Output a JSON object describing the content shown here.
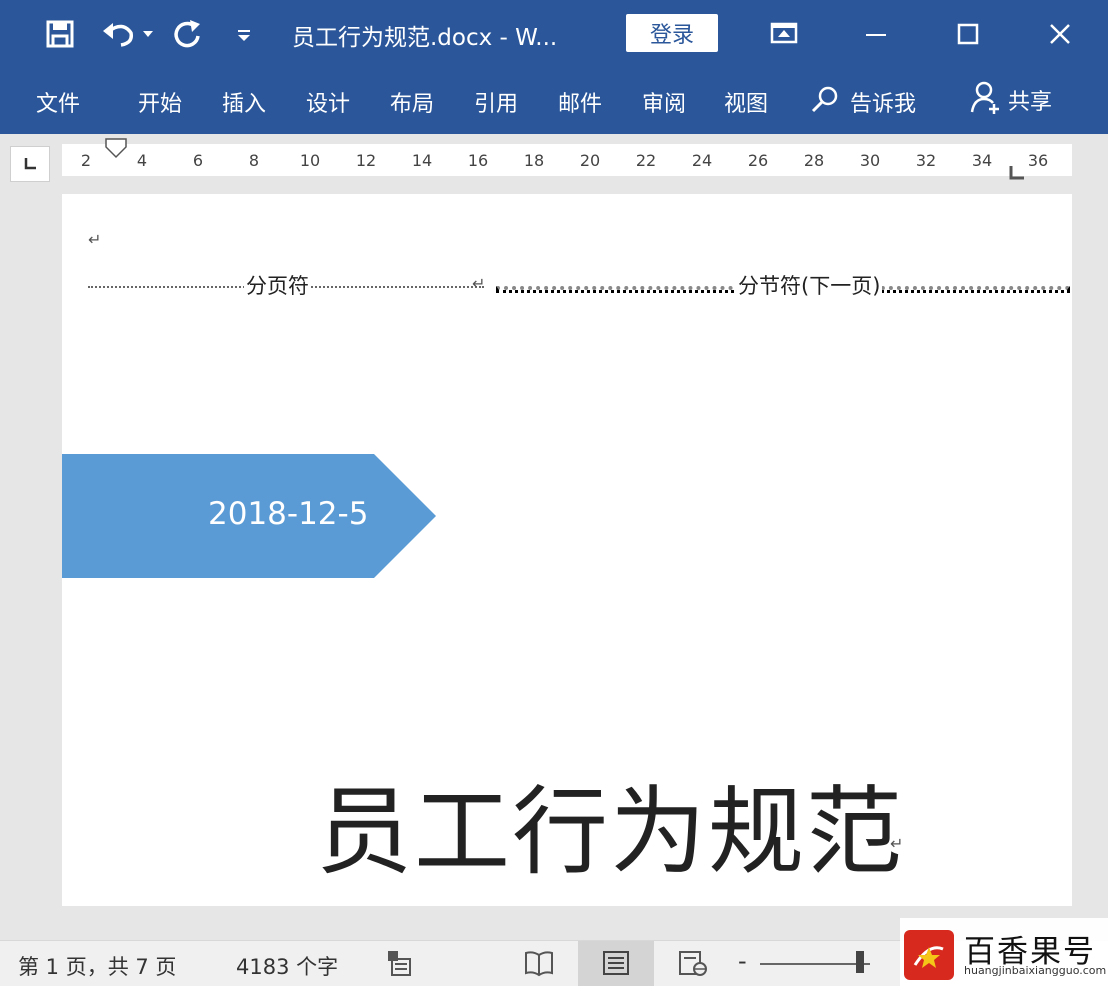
{
  "window": {
    "title": "员工行为规范.docx  -  W...",
    "login_label": "登录"
  },
  "ribbon": {
    "tabs": [
      "文件",
      "开始",
      "插入",
      "设计",
      "布局",
      "引用",
      "邮件",
      "审阅",
      "视图"
    ],
    "tell_me": "告诉我",
    "share": "共享"
  },
  "ruler": {
    "ticks": [
      "2",
      "4",
      "6",
      "8",
      "10",
      "12",
      "14",
      "16",
      "18",
      "20",
      "22",
      "24",
      "26",
      "28",
      "30",
      "32",
      "34",
      "36"
    ]
  },
  "document": {
    "paragraph_mark": "↵",
    "page_break_label": "分页符",
    "section_break_label": "分节符(下一页)",
    "date_text": "2018-12-5",
    "title_text": "员工行为规范",
    "shape_color": "#5b9bd5"
  },
  "statusbar": {
    "page_info": "第 1 页，共 7 页",
    "word_count": "4183 个字",
    "zoom_minus": "-"
  },
  "watermark": {
    "title": "百香果号",
    "url": "huangjinbaixiangguo.com"
  },
  "colors": {
    "ribbon_blue": "#2b579a",
    "accent_shape": "#5b9bd5"
  }
}
